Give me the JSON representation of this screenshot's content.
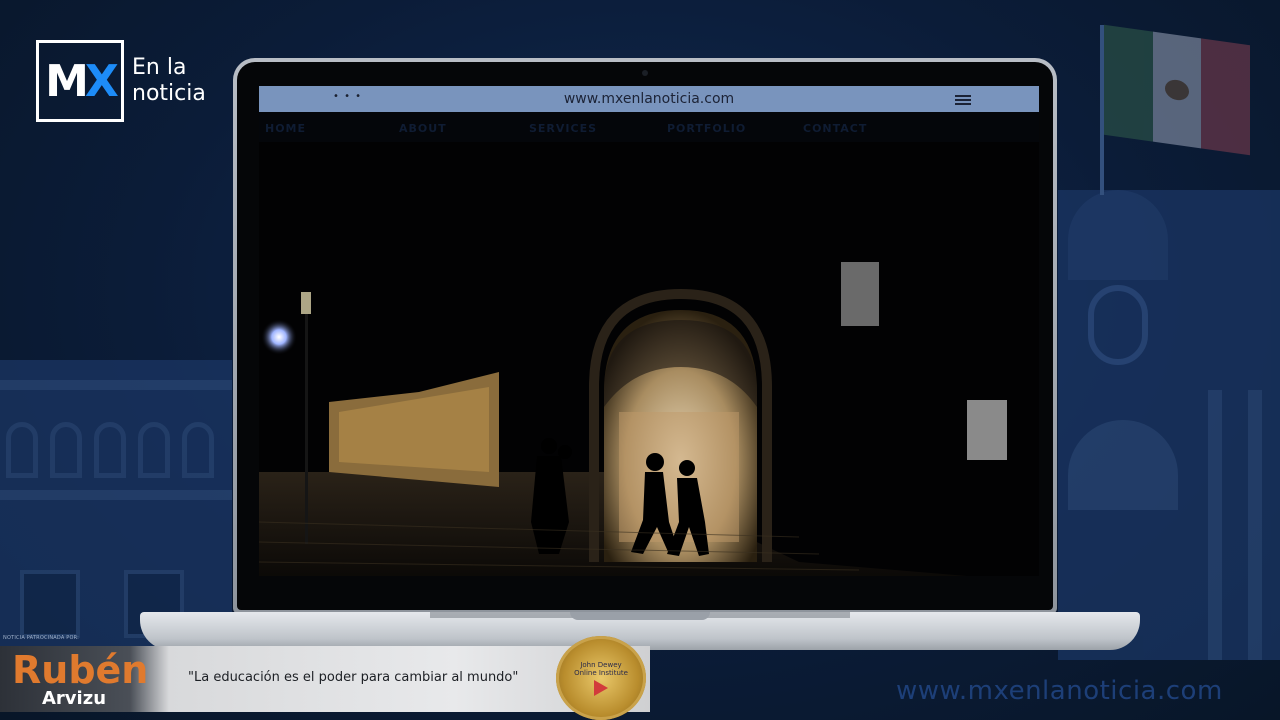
{
  "brand": {
    "logo_mark": "MX",
    "logo_mark_m": "M",
    "logo_mark_x": "X",
    "name_line1": "En la",
    "name_line2": "noticia"
  },
  "browser": {
    "url": "www.mxenlanoticia.com",
    "dots": "• • •",
    "menu_icon": "hamburger-icon"
  },
  "nav": {
    "items": [
      "HOME",
      "ABOUT",
      "SERVICES",
      "PORTFOLIO",
      "CONTACT"
    ]
  },
  "banner": {
    "sponsor_label": "NOTICIA PATROCINADA POR:",
    "sponsor_first": "Rubén",
    "sponsor_last": "Arvizu",
    "quote": "\"La educación es el poder para cambiar al mundo\"",
    "badge_line1": "John Dewey",
    "badge_line2": "Online Institute"
  },
  "footer": {
    "url": "www.mxenlanoticia.com"
  },
  "colors": {
    "background": "#0b1c38",
    "url_bar": "#7994bd",
    "logo_accent": "#1d8cf8",
    "sponsor_orange": "#e07a2e",
    "footer_url": "#1d3f78"
  }
}
